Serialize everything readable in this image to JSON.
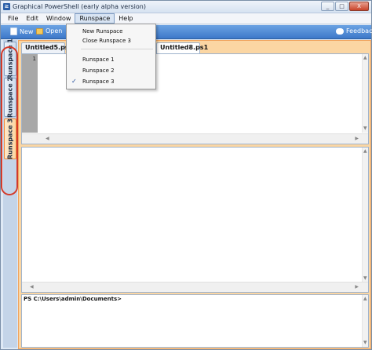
{
  "window": {
    "title": "Graphical PowerShell (early alpha version)",
    "app_icon": "powershell-icon",
    "controls": [
      "_",
      "□",
      "X"
    ]
  },
  "menubar": {
    "items": [
      "File",
      "Edit",
      "Window",
      "Runspace",
      "Help"
    ],
    "active": "Runspace"
  },
  "toolbar": {
    "new_label": "New",
    "open_label": "Open",
    "feedback_label": "Feedback"
  },
  "runspace_tabs": [
    "Runspace 1",
    "Runspace 2",
    "Runspace 3"
  ],
  "active_runspace": "Runspace 3",
  "doc_tabs": [
    "Untitled5.ps1",
    "Untitled8.ps1"
  ],
  "selected_doc_tab": "Untitled8.ps1",
  "editor": {
    "line_numbers": [
      "1"
    ]
  },
  "console": {
    "prompt": "PS C:\\Users\\admin\\Documents>"
  },
  "runspace_menu": {
    "items": [
      "New Runspace",
      "Close Runspace 3",
      "Runspace 1",
      "Runspace 2",
      "Runspace 3"
    ],
    "checked": "Runspace 3"
  },
  "colors": {
    "accent_orange": "#fbd6a3",
    "toolbar_blue": "#3d78c9",
    "highlight_red": "#d33a2a"
  }
}
